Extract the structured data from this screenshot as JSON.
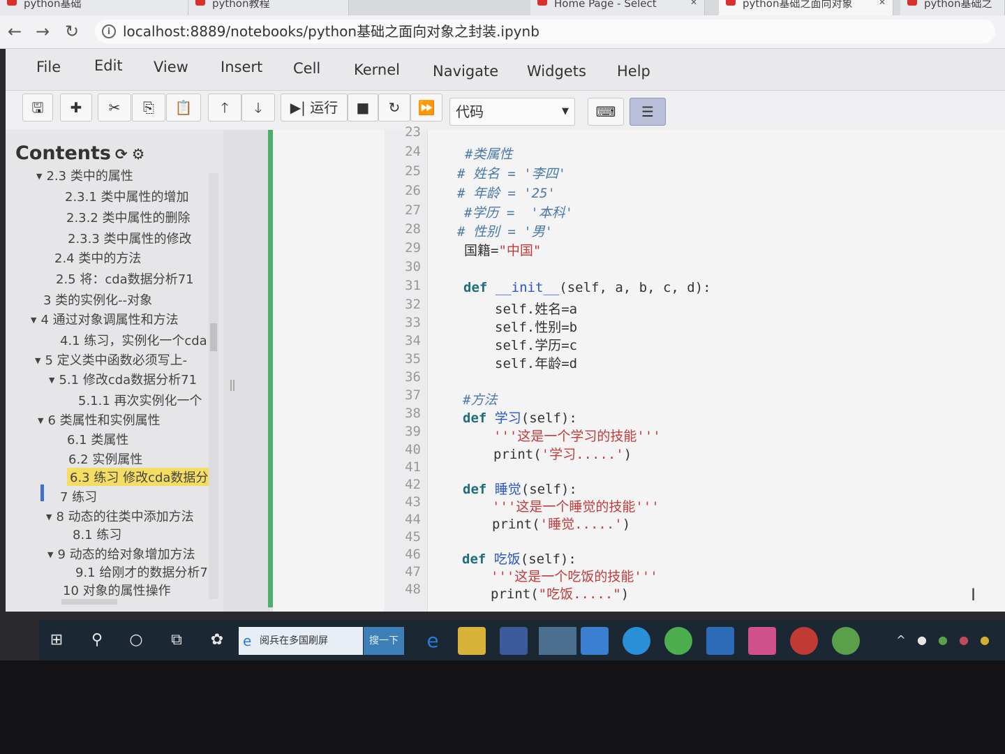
{
  "browser": {
    "tabs": [
      {
        "label": "python基础"
      },
      {
        "label": "python教程"
      },
      {
        "label": "Home Page - Select"
      },
      {
        "label": "python基础之面向对象"
      },
      {
        "label": "python基础之"
      }
    ],
    "url": "localhost:8889/notebooks/python基础之面向对象之封装.ipynb"
  },
  "menu": {
    "items": [
      "File",
      "Edit",
      "View",
      "Insert",
      "Cell",
      "Kernel",
      "Navigate",
      "Widgets",
      "Help"
    ]
  },
  "toolbar": {
    "run_label": "运行",
    "cell_type": "代码"
  },
  "toc": {
    "title": "Contents",
    "items": [
      {
        "text": "2.3 类中的属性"
      },
      {
        "text": "2.3.1 类中属性的增加"
      },
      {
        "text": "2.3.2 类中属性的删除"
      },
      {
        "text": "2.3.3 类中属性的修改"
      },
      {
        "text": "2.4 类中的方法"
      },
      {
        "text": "2.5 将：cda数据分析71"
      },
      {
        "text": "3 类的实例化--对象"
      },
      {
        "text": "4 通过对象调属性和方法"
      },
      {
        "text": "4.1 练习，实例化一个cda"
      },
      {
        "text": "5 定义类中函数必须写上-"
      },
      {
        "text": "5.1 修改cda数据分析71"
      },
      {
        "text": "5.1.1 再次实例化一个"
      },
      {
        "text": "6 类属性和实例属性"
      },
      {
        "text": "6.1 类属性"
      },
      {
        "text": "6.2 实例属性"
      },
      {
        "text": "6.3 练习 修改cda数据分"
      },
      {
        "text": "7 练习"
      },
      {
        "text": "8 动态的往类中添加方法"
      },
      {
        "text": "8.1 练习"
      },
      {
        "text": "9 动态的给对象增加方法"
      },
      {
        "text": "9.1 给刚才的数据分析7"
      },
      {
        "text": "10 对象的属性操作"
      }
    ]
  },
  "code": {
    "line_numbers": [
      "23",
      "24",
      "25",
      "26",
      "27",
      "28",
      "29",
      "30",
      "31",
      "32",
      "33",
      "34",
      "35",
      "36",
      "37",
      "38",
      "39",
      "40",
      "41",
      "42",
      "43",
      "44",
      "45",
      "46",
      "47",
      "48"
    ],
    "l24": "#类属性",
    "l25": "# 姓名 = '李四'",
    "l26": "# 年龄 = '25'",
    "l27": "#学历 =  '本科'",
    "l28": "# 性别 = '男'",
    "l29a": "国籍=",
    "l29b": "\"中国\"",
    "l31a": "def ",
    "l31b": "__init__",
    "l31c": "(self, a, b, c, d):",
    "l32": "self.姓名=a",
    "l33": "self.性别=b",
    "l34": "self.学历=c",
    "l35": "self.年龄=d",
    "l37": "#方法",
    "l38a": "def ",
    "l38b": "学习",
    "l38c": "(self):",
    "l39": "'''这是一个学习的技能'''",
    "l40a": "print(",
    "l40b": "'学习.....'",
    "l40c": ")",
    "l42a": "def ",
    "l42b": "睡觉",
    "l42c": "(self):",
    "l43": "'''这是一个睡觉的技能'''",
    "l44a": "print(",
    "l44b": "'睡觉.....'",
    "l44c": ")",
    "l46a": "def ",
    "l46b": "吃饭",
    "l46c": "(self):",
    "l47": "'''这是一个吃饭的技能'''",
    "l48a": "print(",
    "l48b": "\"吃饭.....\"",
    "l48c": ")"
  },
  "taskbar": {
    "search_text": "阅兵在多国刷屏",
    "search_button": "搜一下"
  },
  "colors": {
    "cell_active_bar": "#4caf6a",
    "toc_highlight": "#f5dd62",
    "taskbar_bg": "#1b2733"
  }
}
